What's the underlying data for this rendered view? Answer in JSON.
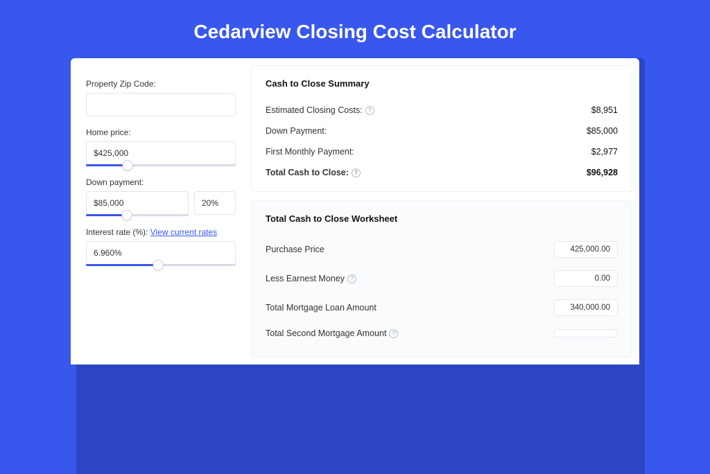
{
  "title": "Cedarview Closing Cost Calculator",
  "inputs": {
    "zip_label": "Property Zip Code:",
    "zip_value": "",
    "homeprice_label": "Home price:",
    "homeprice_value": "$425,000",
    "homeprice_slider_pct": 28,
    "downpayment_label": "Down payment:",
    "downpayment_value": "$85,000",
    "downpayment_pct_value": "20%",
    "downpayment_slider_pct": 40,
    "interest_label": "Interest rate (%): ",
    "interest_link": "View current rates",
    "interest_value": "6.960%",
    "interest_slider_pct": 48
  },
  "summary": {
    "heading": "Cash to Close Summary",
    "rows": [
      {
        "label": "Estimated Closing Costs:",
        "help": true,
        "value": "$8,951"
      },
      {
        "label": "Down Payment:",
        "help": false,
        "value": "$85,000"
      },
      {
        "label": "First Monthly Payment:",
        "help": false,
        "value": "$2,977"
      }
    ],
    "total": {
      "label": "Total Cash to Close:",
      "help": true,
      "value": "$96,928"
    }
  },
  "worksheet": {
    "heading": "Total Cash to Close Worksheet",
    "rows": [
      {
        "label": "Purchase Price",
        "help": false,
        "value": "425,000.00"
      },
      {
        "label": "Less Earnest Money",
        "help": true,
        "value": "0.00"
      },
      {
        "label": "Total Mortgage Loan Amount",
        "help": false,
        "value": "340,000.00"
      },
      {
        "label": "Total Second Mortgage Amount",
        "help": true,
        "value": ""
      }
    ]
  }
}
